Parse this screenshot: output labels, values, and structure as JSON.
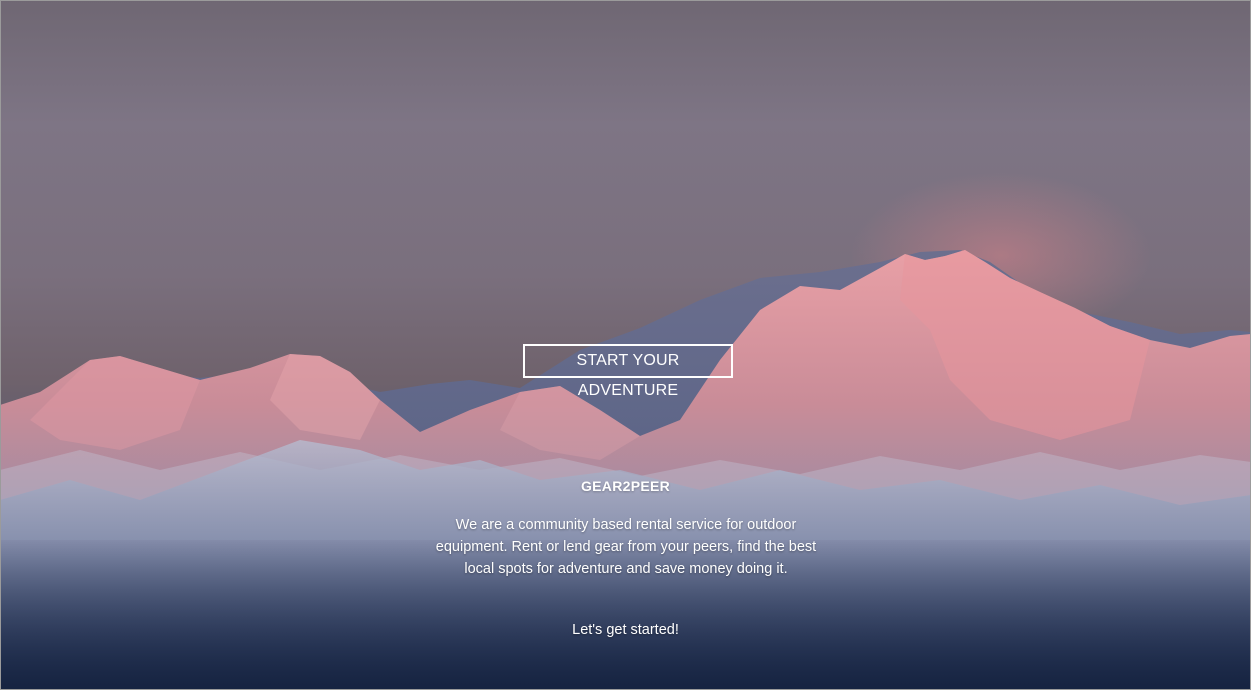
{
  "hero": {
    "background_image": "mountain-range-at-sunrise",
    "colors": {
      "sky_top": "#6f6773",
      "sky_mid": "#7e7585",
      "peak_glow": "#e89aa0",
      "snow": "#cfd6e4",
      "shadow": "#3a4a70",
      "base": "#1d2c4d"
    }
  },
  "cta": {
    "label": "START YOUR ADVENTURE"
  },
  "brand": {
    "name": "GEAR2PEER"
  },
  "description": "We are a community based rental service for outdoor equipment. Rent or lend gear from your peers, find the best local spots for adventure and save money doing it.",
  "get_started": "Let's get started!"
}
